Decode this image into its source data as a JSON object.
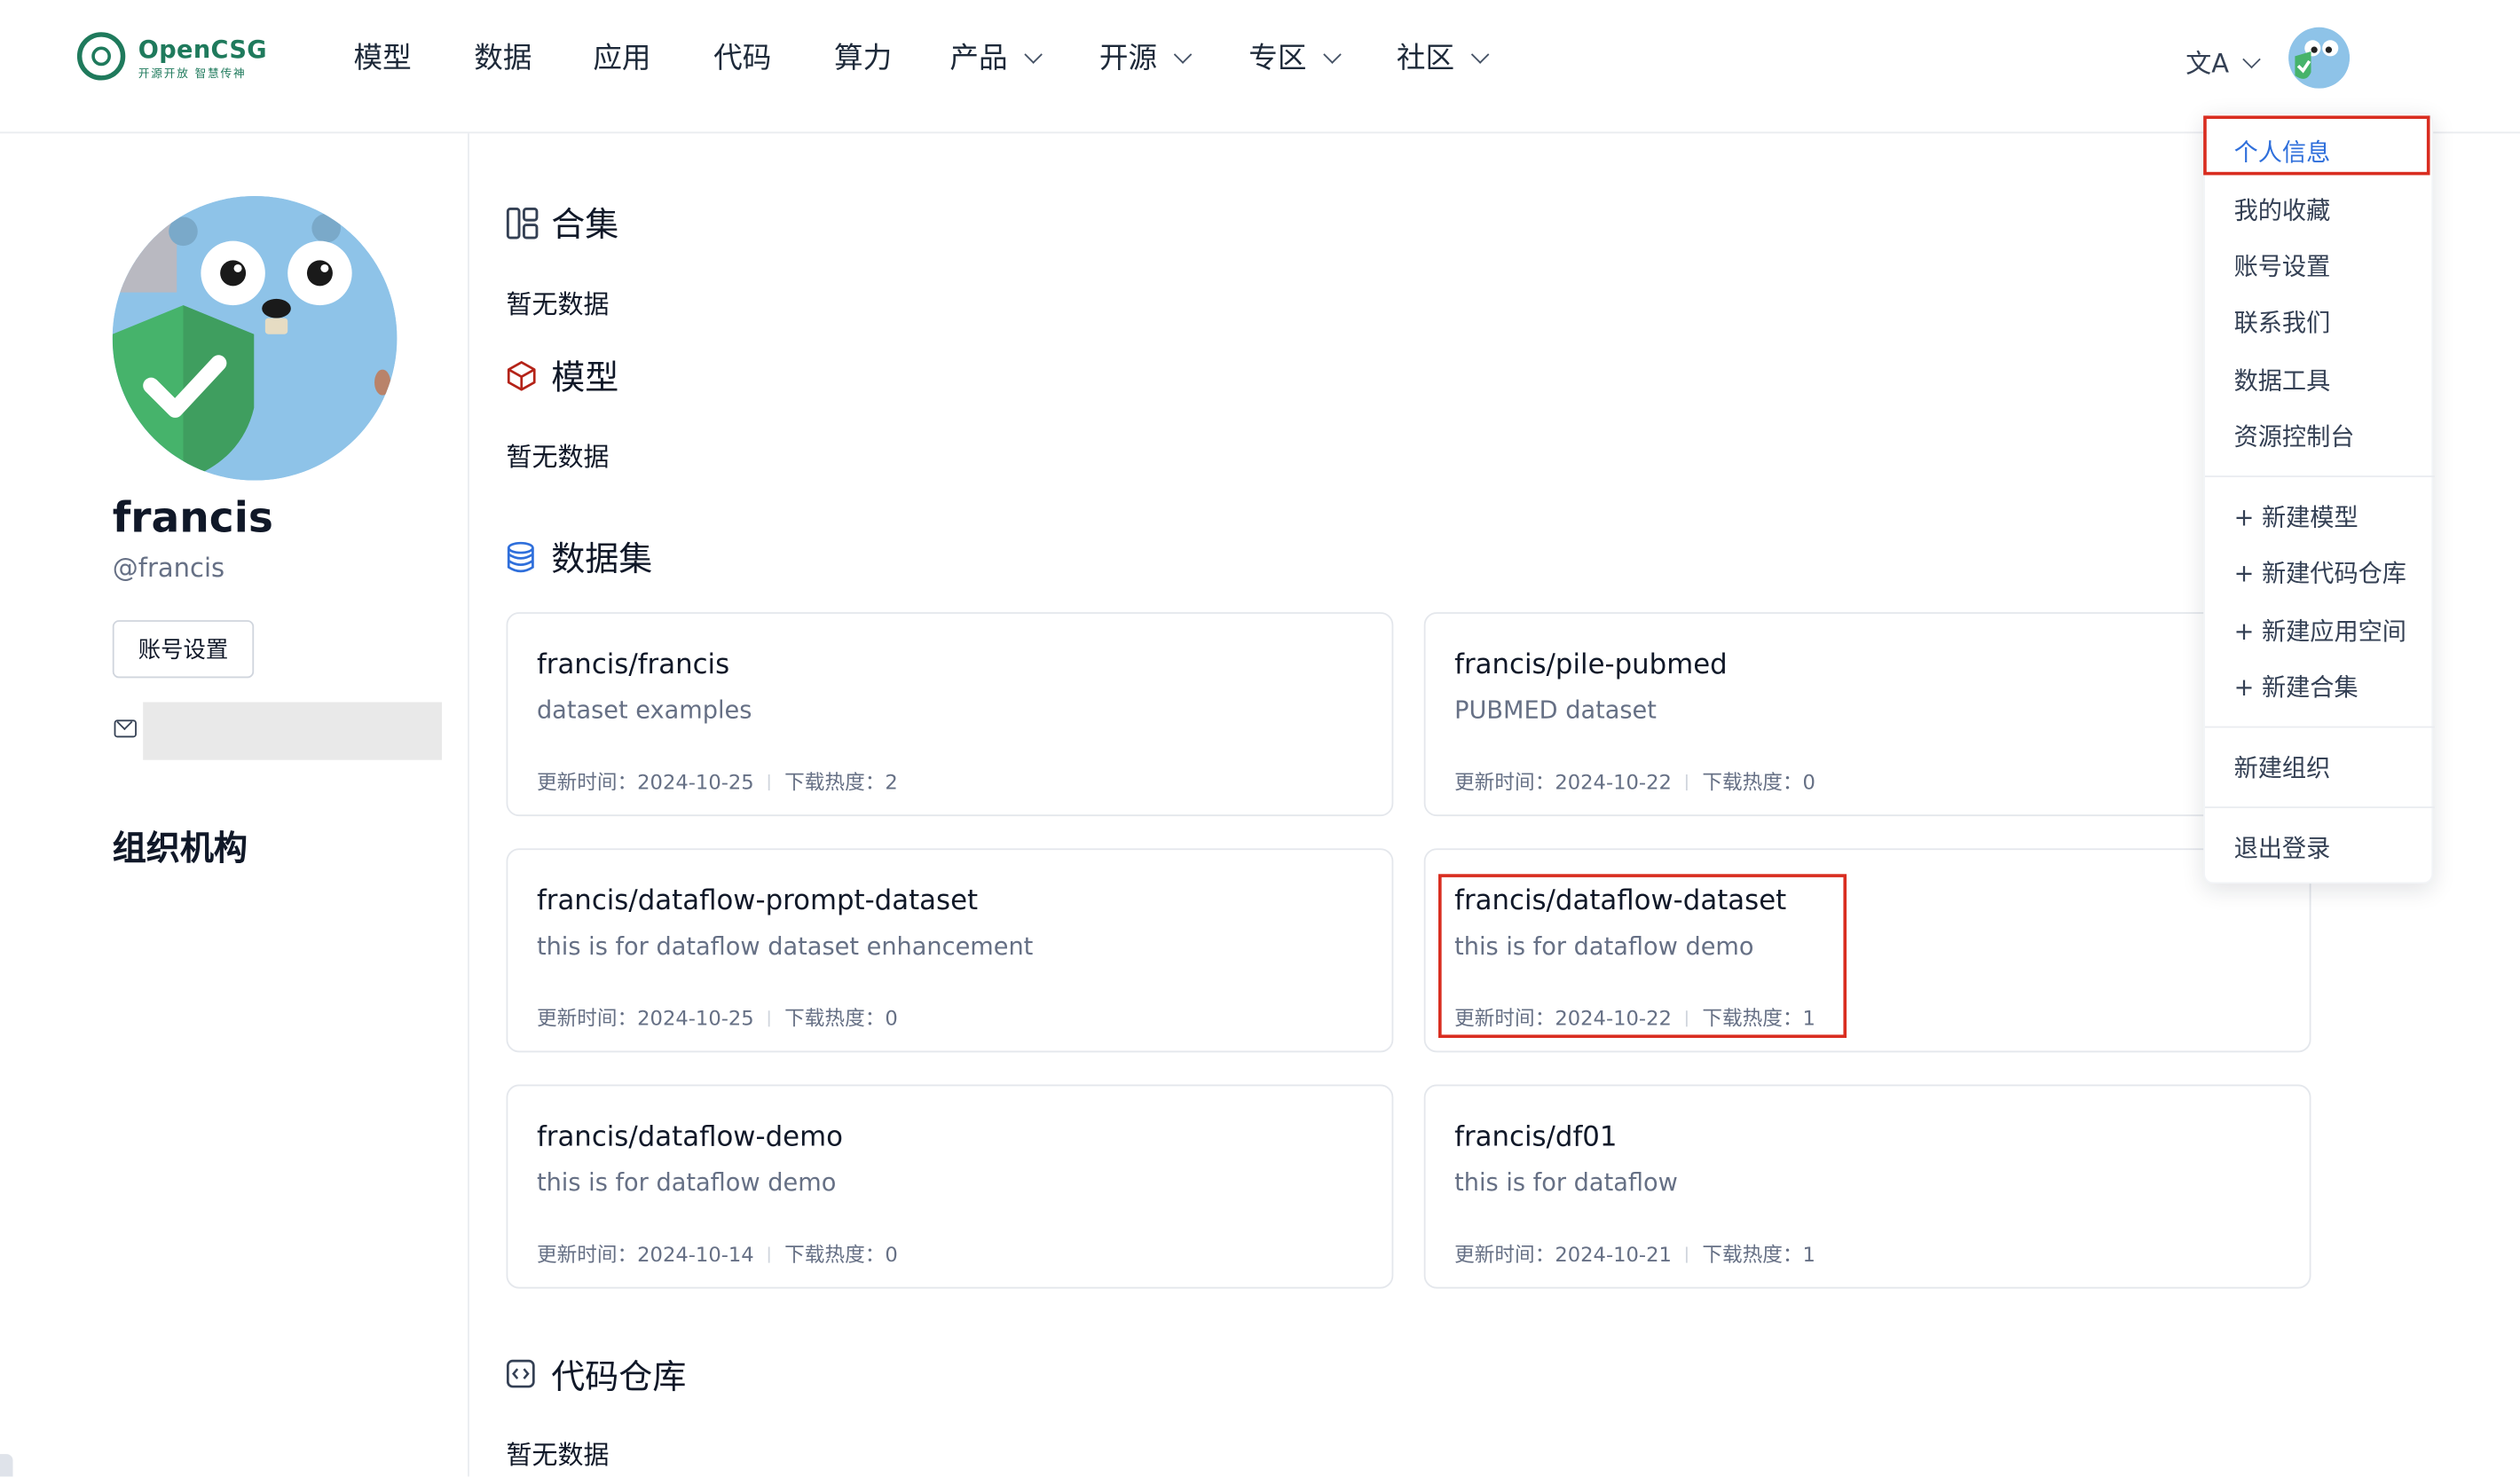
{
  "logo": {
    "name": "OpenCSG",
    "tagline": "开源开放 智慧传神"
  },
  "nav": {
    "items": [
      {
        "label": "模型"
      },
      {
        "label": "数据"
      },
      {
        "label": "应用"
      },
      {
        "label": "代码"
      },
      {
        "label": "算力"
      },
      {
        "label": "产品"
      },
      {
        "label": "开源"
      },
      {
        "label": "专区"
      },
      {
        "label": "社区"
      }
    ],
    "lang_icon": "文A"
  },
  "profile": {
    "name": "francis",
    "handle": "@francis",
    "account_button": "账号设置",
    "org_title": "组织机构"
  },
  "sections": {
    "collections": {
      "title": "合集",
      "empty": "暂无数据"
    },
    "models": {
      "title": "模型",
      "empty": "暂无数据"
    },
    "datasets": {
      "title": "数据集"
    },
    "code": {
      "title": "代码仓库",
      "empty": "暂无数据"
    }
  },
  "datasets": [
    {
      "title": "francis/francis",
      "desc": "dataset examples",
      "updated_label": "更新时间：2024-10-25",
      "downloads_label": "下载热度：2"
    },
    {
      "title": "francis/pile-pubmed",
      "desc": "PUBMED dataset",
      "updated_label": "更新时间：2024-10-22",
      "downloads_label": "下载热度：0"
    },
    {
      "title": "francis/dataflow-prompt-dataset",
      "desc": "this is for dataflow dataset enhancement",
      "updated_label": "更新时间：2024-10-25",
      "downloads_label": "下载热度：0"
    },
    {
      "title": "francis/dataflow-dataset",
      "desc": "this is for dataflow demo",
      "updated_label": "更新时间：2024-10-22",
      "downloads_label": "下载热度：1"
    },
    {
      "title": "francis/dataflow-demo",
      "desc": "this is for dataflow demo",
      "updated_label": "更新时间：2024-10-14",
      "downloads_label": "下载热度：0"
    },
    {
      "title": "francis/df01",
      "desc": "this is for dataflow",
      "updated_label": "更新时间：2024-10-21",
      "downloads_label": "下载热度：1"
    }
  ],
  "dropdown": {
    "items": [
      "个人信息",
      "我的收藏",
      "账号设置",
      "联系我们",
      "数据工具",
      "资源控制台"
    ],
    "create_items": [
      "+ 新建模型",
      "+ 新建代码仓库",
      "+ 新建应用空间",
      "+ 新建合集"
    ],
    "new_org": "新建组织",
    "logout": "退出登录"
  },
  "colors": {
    "brand": "#1f7a5c",
    "highlight": "#d92d20",
    "link": "#2f6fdb",
    "muted": "#667085"
  }
}
